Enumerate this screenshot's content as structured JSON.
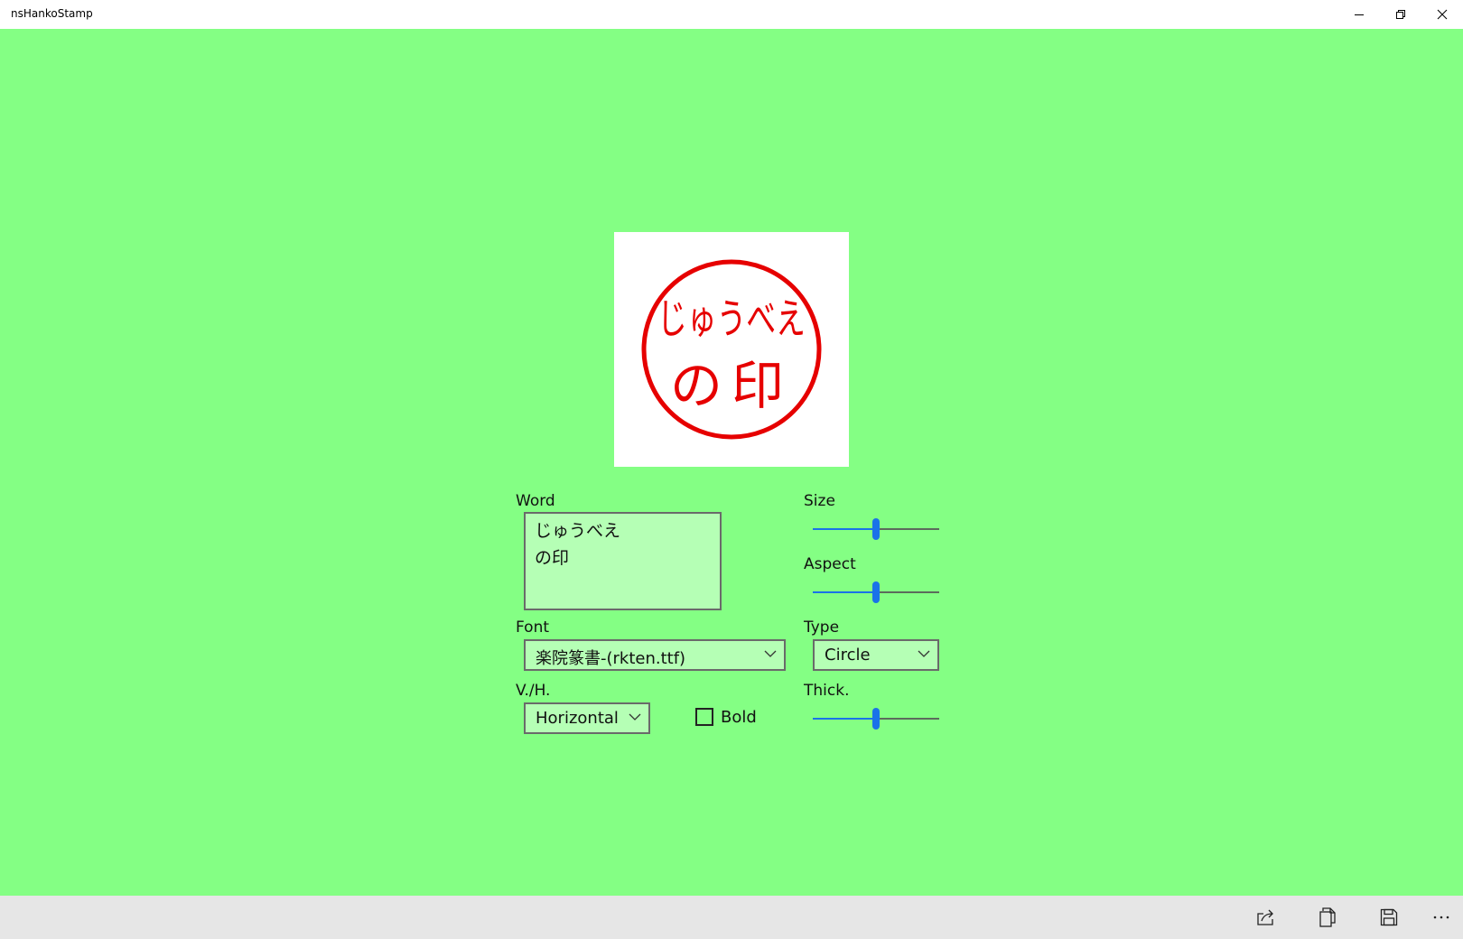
{
  "window": {
    "title": "nsHankoStamp"
  },
  "stamp": {
    "line1": "じゅうべえ",
    "line2": "の印",
    "color": "#e60000"
  },
  "word": {
    "label": "Word",
    "lines": [
      "じゅうべえ",
      "の印"
    ]
  },
  "font": {
    "label": "Font",
    "value": "楽院篆書-(rkten.ttf)"
  },
  "orientation": {
    "label": "V./H.",
    "value": "Horizontal"
  },
  "bold": {
    "label": "Bold",
    "checked": false
  },
  "size": {
    "label": "Size",
    "value": 0.5
  },
  "aspect": {
    "label": "Aspect",
    "value": 0.5
  },
  "type": {
    "label": "Type",
    "value": "Circle"
  },
  "thick": {
    "label": "Thick.",
    "value": 0.5
  },
  "colors": {
    "background": "#84ff84",
    "field": "#b5ffb5",
    "accent": "#1a73e8",
    "appbar": "#e6e6e6"
  },
  "appbar_icons": [
    "share-icon",
    "copy-icon",
    "save-icon",
    "more-icon"
  ]
}
